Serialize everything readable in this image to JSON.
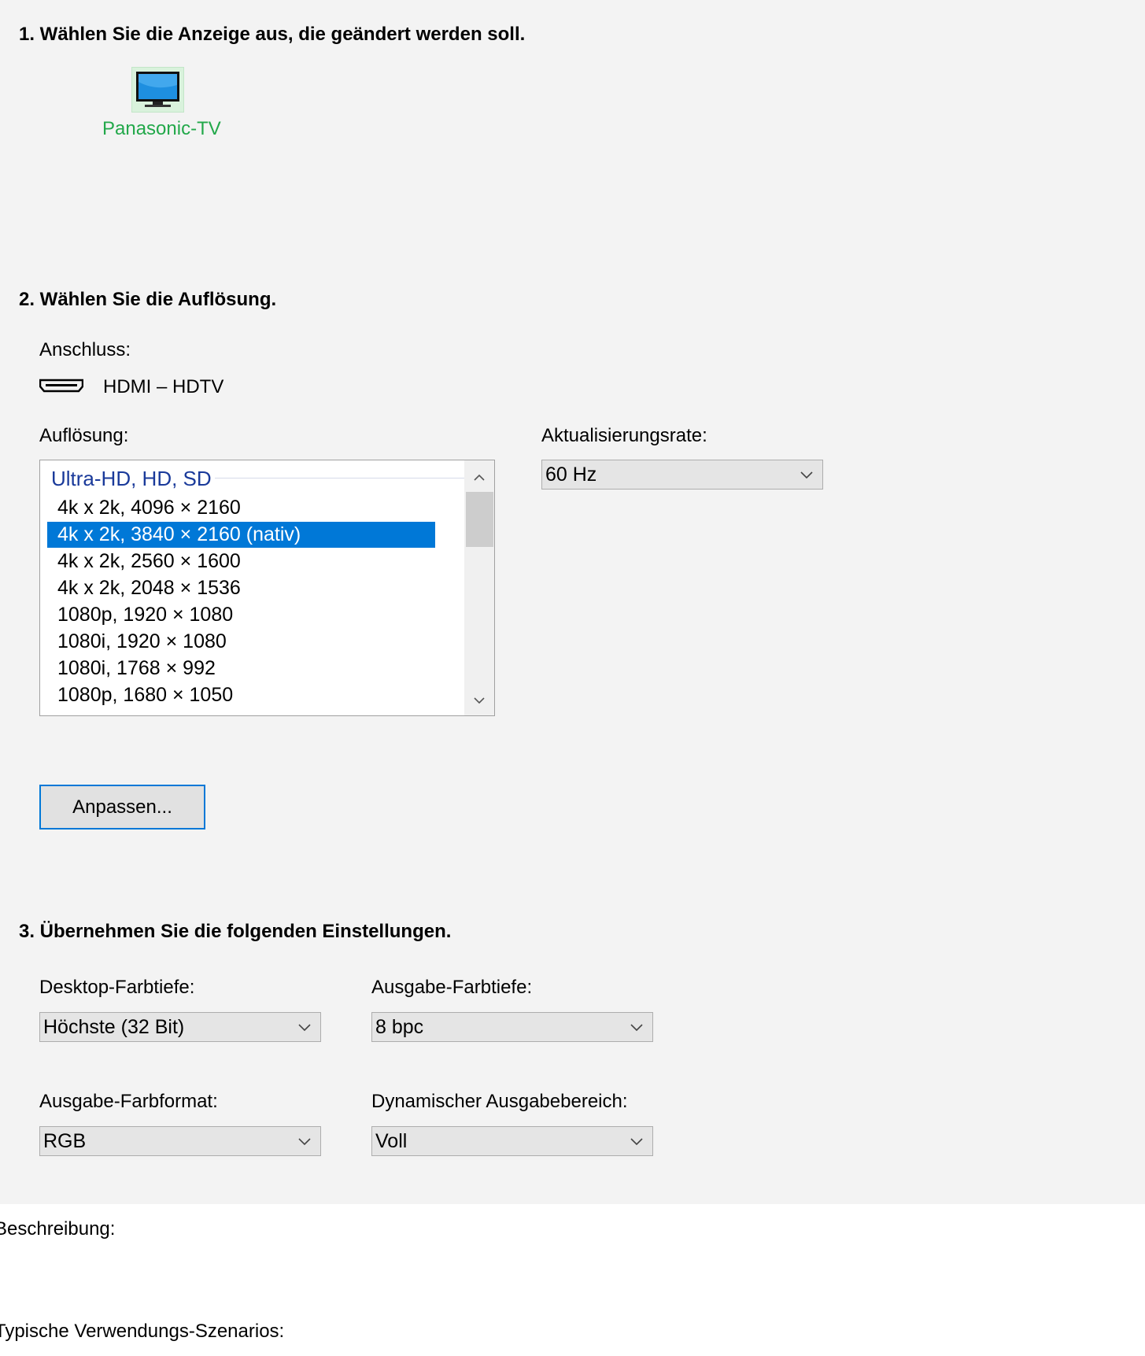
{
  "step1": {
    "heading": "1. Wählen Sie die Anzeige aus, die geändert werden soll.",
    "display_name": "Panasonic-TV"
  },
  "step2": {
    "heading": "2. Wählen Sie die Auflösung.",
    "connection_label": "Anschluss:",
    "connection_value": "HDMI – HDTV",
    "resolution_label": "Auflösung:",
    "refresh_label": "Aktualisierungsrate:",
    "refresh_value": "60 Hz",
    "group_header": "Ultra-HD, HD, SD",
    "resolutions": [
      {
        "label": "4k x 2k, 4096 × 2160",
        "selected": false
      },
      {
        "label": "4k x 2k, 3840 × 2160 (nativ)",
        "selected": true
      },
      {
        "label": "4k x 2k, 2560 × 1600",
        "selected": false
      },
      {
        "label": "4k x 2k, 2048 × 1536",
        "selected": false
      },
      {
        "label": "1080p, 1920 × 1080",
        "selected": false
      },
      {
        "label": "1080i, 1920 × 1080",
        "selected": false
      },
      {
        "label": "1080i, 1768 × 992",
        "selected": false
      },
      {
        "label": "1080p, 1680 × 1050",
        "selected": false
      }
    ],
    "customize_button": "Anpassen..."
  },
  "step3": {
    "heading": "3. Übernehmen Sie die folgenden Einstellungen.",
    "desktop_depth_label": "Desktop-Farbtiefe:",
    "desktop_depth_value": "Höchste (32 Bit)",
    "output_depth_label": "Ausgabe-Farbtiefe:",
    "output_depth_value": "8 bpc",
    "output_format_label": "Ausgabe-Farbformat:",
    "output_format_value": "RGB",
    "dynamic_range_label": "Dynamischer Ausgabebereich:",
    "dynamic_range_value": "Voll"
  },
  "footer": {
    "description_label": "Beschreibung:",
    "scenarios_label": "Typische Verwendungs-Szenarios:"
  },
  "colors": {
    "accent": "#0078d7",
    "display_name": "#22a84a",
    "group_header": "#1a3a9a",
    "panel_bg": "#f3f3f3"
  },
  "icons": {
    "display": "monitor-icon",
    "connection": "hdmi-icon",
    "dropdown": "chevron-down-icon"
  }
}
